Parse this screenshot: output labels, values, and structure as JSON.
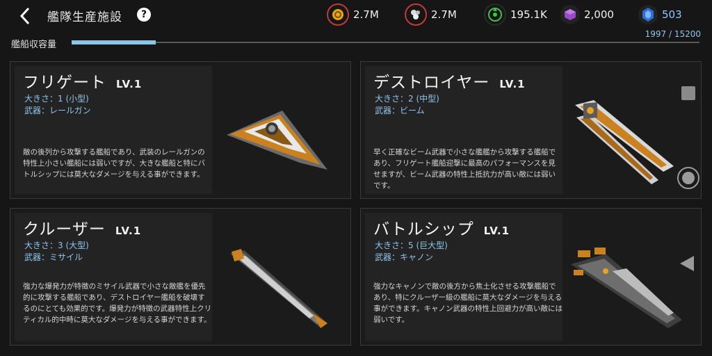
{
  "header": {
    "title": "艦隊生産施設",
    "help_label": "?"
  },
  "resources": [
    {
      "icon": "gold-coin-icon",
      "value": "2.7M",
      "color": "#e9a31c"
    },
    {
      "icon": "crystal-molecule-icon",
      "value": "2.7M",
      "color": "#c84040"
    },
    {
      "icon": "green-energy-icon",
      "value": "195.1K",
      "color": "#3ec24a"
    },
    {
      "icon": "purple-cube-icon",
      "value": "2,000",
      "color": "#9b4bc9"
    },
    {
      "icon": "blue-gem-icon",
      "value": "503",
      "color": "#2b6fd8"
    }
  ],
  "capacity": {
    "label": "艦船収容量",
    "count": "1997 / 15200",
    "current": 1997,
    "max": 15200
  },
  "ships": [
    {
      "name": "フリゲート",
      "level": "LV.1",
      "size": "大きさ：1 (小型)",
      "weapon": "武器：レールガン",
      "description": "敵の後列から攻撃する艦船であり、武装のレールガンの特性上小さい艦船には弱いですが、大きな艦船と特にバトルシップには莫大なダメージを与える事ができます。"
    },
    {
      "name": "デストロイヤー",
      "level": "LV.1",
      "size": "大きさ：2 (中型)",
      "weapon": "武器：ビーム",
      "description": "早く正確なビーム武器で小さな艦艦から攻撃する艦船であり、フリゲート艦船迎撃に最高のパフォーマンスを見せますが、ビーム武器の特性上抵抗力が高い敵には弱いです。"
    },
    {
      "name": "クルーザー",
      "level": "LV.1",
      "size": "大きさ：3 (大型)",
      "weapon": "武器：ミサイル",
      "description": "強力な爆発力が特徴のミサイル武器で小さな敵艦を優先的に攻撃する艦船であり、デストロイヤー艦船を破壊するのにとても効果的です。爆発力が特徴の武器特性上クリティカル的中時に莫大なダメージを与える事ができます。"
    },
    {
      "name": "バトルシップ",
      "level": "LV.1",
      "size": "大きさ：5 (巨大型)",
      "weapon": "武器：キャノン",
      "description": "強力なキャノンで敵の後方から焦土化させる攻撃艦船であり、特にクルーザー級の艦船に莫大なダメージを与える事ができます。キャノン武器の特性上回避力が高い敵には弱いです。"
    }
  ]
}
